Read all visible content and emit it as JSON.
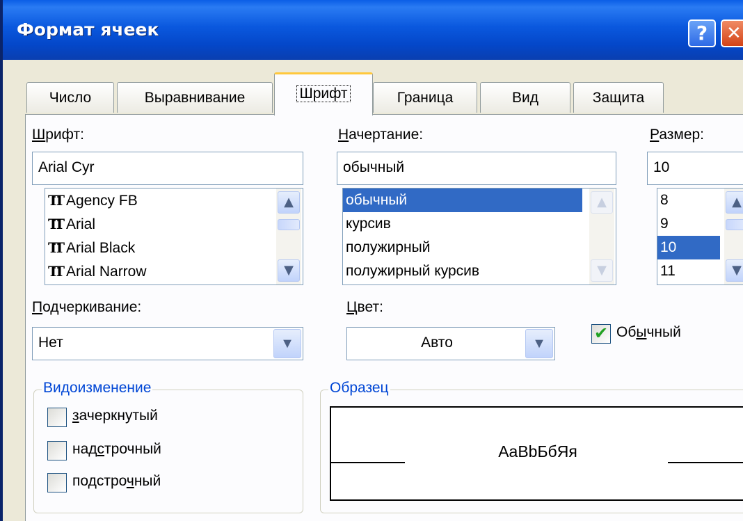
{
  "window": {
    "title": "Формат ячеек",
    "help_glyph": "?",
    "close_glyph": "✕"
  },
  "tabs": [
    {
      "label": "Число"
    },
    {
      "label": "Выравнивание"
    },
    {
      "label": "Шрифт"
    },
    {
      "label": "Граница"
    },
    {
      "label": "Вид"
    },
    {
      "label": "Защита"
    }
  ],
  "active_tab": "Шрифт",
  "font": {
    "label": "Шрифт:",
    "value": "Arial Cyr",
    "items": [
      "Agency FB",
      "Arial",
      "Arial Black",
      "Arial Narrow"
    ],
    "item_icon": "truetype-icon",
    "item_icon_glyph": "TT"
  },
  "style": {
    "label": "Начертание:",
    "value": "обычный",
    "items": [
      "обычный",
      "курсив",
      "полужирный",
      "полужирный курсив"
    ],
    "selected": "обычный"
  },
  "size": {
    "label": "Размер:",
    "value": "10",
    "items": [
      "8",
      "9",
      "10",
      "11"
    ],
    "selected": "10"
  },
  "underline": {
    "label": "Подчеркивание:",
    "value": "Нет"
  },
  "color": {
    "label": "Цвет:",
    "value": "Авто"
  },
  "normal_font": {
    "label_pre": "Об",
    "label_key": "ы",
    "label_post": "чный",
    "checked": true
  },
  "effects": {
    "legend": "Видоизменение",
    "items": [
      {
        "pre": "",
        "key": "з",
        "post": "ачеркнутый",
        "checked": false
      },
      {
        "pre": "над",
        "key": "с",
        "post": "трочный",
        "checked": false
      },
      {
        "pre": "подстро",
        "key": "ч",
        "post": "ный",
        "checked": false
      }
    ]
  },
  "preview": {
    "legend": "Образец",
    "text": "AaBbБбЯя"
  },
  "glyphs": {
    "scroll_up": "▲",
    "scroll_down": "▼",
    "combo_arrow": "▼",
    "check": "✔"
  }
}
